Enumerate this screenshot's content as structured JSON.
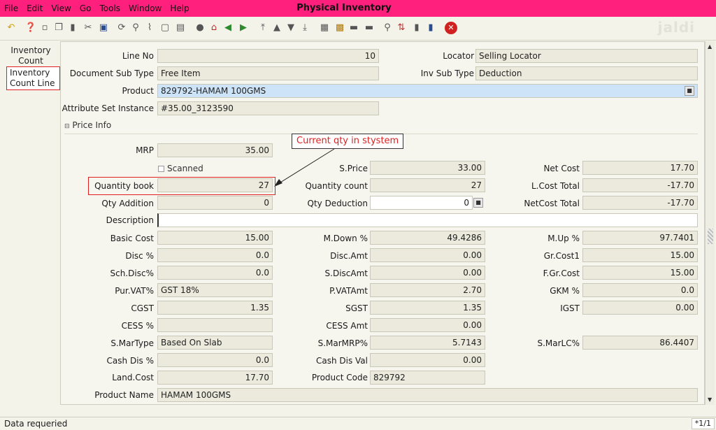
{
  "window": {
    "title": "Physical Inventory"
  },
  "menu": [
    "File",
    "Edit",
    "View",
    "Go",
    "Tools",
    "Window",
    "Help"
  ],
  "logo": "jaldi",
  "tabs": [
    "Inventory Count",
    "Inventory Count Line"
  ],
  "fields": {
    "line_no": {
      "label": "Line No",
      "value": "10"
    },
    "locator": {
      "label": "Locator",
      "value": "Selling Locator"
    },
    "doc_sub_type": {
      "label": "Document Sub Type",
      "value": "Free Item"
    },
    "inv_sub_type": {
      "label": "Inv Sub Type",
      "value": "Deduction"
    },
    "product": {
      "label": "Product",
      "value": "829792-HAMAM 100GMS"
    },
    "attr_set": {
      "label": "Attribute Set Instance",
      "value": "#35.00_3123590"
    },
    "mrp": {
      "label": "MRP",
      "value": "35.00"
    },
    "scanned": {
      "label": "Scanned"
    },
    "s_price": {
      "label": "S.Price",
      "value": "33.00"
    },
    "net_cost": {
      "label": "Net Cost",
      "value": "17.70"
    },
    "qty_book": {
      "label": "Quantity book",
      "value": "27"
    },
    "qty_count": {
      "label": "Quantity count",
      "value": "27"
    },
    "l_cost_total": {
      "label": "L.Cost Total",
      "value": "-17.70"
    },
    "qty_addition": {
      "label": "Qty Addition",
      "value": "0"
    },
    "qty_deduction": {
      "label": "Qty Deduction",
      "value": "0"
    },
    "netcost_total": {
      "label": "NetCost Total",
      "value": "-17.70"
    },
    "description": {
      "label": "Description",
      "value": ""
    },
    "basic_cost": {
      "label": "Basic Cost",
      "value": "15.00"
    },
    "m_down": {
      "label": "M.Down %",
      "value": "49.4286"
    },
    "m_up": {
      "label": "M.Up %",
      "value": "97.7401"
    },
    "disc_pct": {
      "label": "Disc %",
      "value": "0.0"
    },
    "disc_amt": {
      "label": "Disc.Amt",
      "value": "0.00"
    },
    "gr_cost1": {
      "label": "Gr.Cost1",
      "value": "15.00"
    },
    "sch_disc": {
      "label": "Sch.Disc%",
      "value": "0.0"
    },
    "s_disc_amt": {
      "label": "S.DiscAmt",
      "value": "0.00"
    },
    "f_gr_cost": {
      "label": "F.Gr.Cost",
      "value": "15.00"
    },
    "pur_vat": {
      "label": "Pur.VAT%",
      "value": "GST 18%"
    },
    "p_vat_amt": {
      "label": "P.VATAmt",
      "value": "2.70"
    },
    "gkm": {
      "label": "GKM %",
      "value": "0.0"
    },
    "cgst": {
      "label": "CGST",
      "value": "1.35"
    },
    "sgst": {
      "label": "SGST",
      "value": "1.35"
    },
    "igst": {
      "label": "IGST",
      "value": "0.00"
    },
    "cess_pct": {
      "label": "CESS %",
      "value": ""
    },
    "cess_amt": {
      "label": "CESS Amt",
      "value": "0.00"
    },
    "s_mar_type": {
      "label": "S.MarType",
      "value": "Based On Slab"
    },
    "s_mar_mrp": {
      "label": "S.MarMRP%",
      "value": "5.7143"
    },
    "s_mar_lc": {
      "label": "S.MarLC%",
      "value": "86.4407"
    },
    "cash_dis_pct": {
      "label": "Cash Dis %",
      "value": "0.0"
    },
    "cash_dis_val": {
      "label": "Cash Dis Val",
      "value": "0.00"
    },
    "land_cost": {
      "label": "Land.Cost",
      "value": "17.70"
    },
    "product_code": {
      "label": "Product Code",
      "value": "829792"
    },
    "product_name": {
      "label": "Product Name",
      "value": "HAMAM 100GMS"
    }
  },
  "section": {
    "label": "Price Info"
  },
  "annotation": {
    "text": "Current qty in stystem"
  },
  "status": {
    "text": "Data requeried",
    "pager": "*1/1"
  },
  "colors": {
    "title_bar": "#ff1f7c",
    "highlight": "#e02020",
    "selected_field": "#cde3f7"
  }
}
